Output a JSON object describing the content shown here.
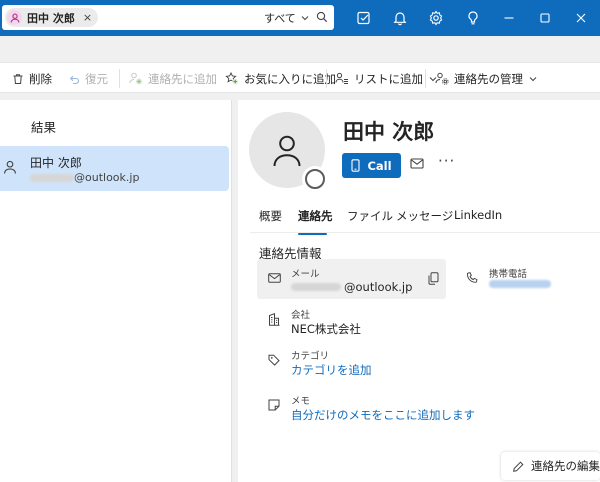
{
  "search": {
    "chip_label": "田中 次郎",
    "chip_close": "×",
    "scope_label": "すべて",
    "scope_chevron": "⌄"
  },
  "titlebar_icons": [
    "tasks-icon",
    "bell-icon",
    "gear-icon",
    "lightbulb-icon",
    "minimize-icon",
    "maximize-icon",
    "close-icon"
  ],
  "ribbon": {
    "delete": "削除",
    "undo": "復元",
    "add_contact": "連絡先に追加",
    "add_favorite": "お気に入りに追加",
    "add_to_list": "リストに追加",
    "manage_contacts": "連絡先の管理"
  },
  "left": {
    "results_heading": "結果",
    "item": {
      "name": "田中 次郎",
      "email_domain": "@outlook.jp"
    }
  },
  "contact": {
    "name": "田中 次郎",
    "call_label": "Call",
    "more_label": "···"
  },
  "tabs": [
    {
      "label": "概要"
    },
    {
      "label": "連絡先"
    },
    {
      "label": "ファイル"
    },
    {
      "label": "メッセージ"
    },
    {
      "label": "LinkedIn"
    }
  ],
  "active_tab": "連絡先",
  "info": {
    "heading": "連絡先情報",
    "email": {
      "label": "メール",
      "value_domain": "@outlook.jp"
    },
    "mobile": {
      "label": "携帯電話"
    },
    "company": {
      "label": "会社",
      "value": "NEC株式会社"
    },
    "category": {
      "label": "カテゴリ",
      "value": "カテゴリを追加"
    },
    "memo": {
      "label": "メモ",
      "value": "自分だけのメモをここに追加します"
    }
  },
  "edit_button": "連絡先の編集",
  "colors": {
    "accent": "#0f6cbd",
    "selected_bg": "#cfe4fa",
    "page_bg": "#f0f0f0"
  }
}
